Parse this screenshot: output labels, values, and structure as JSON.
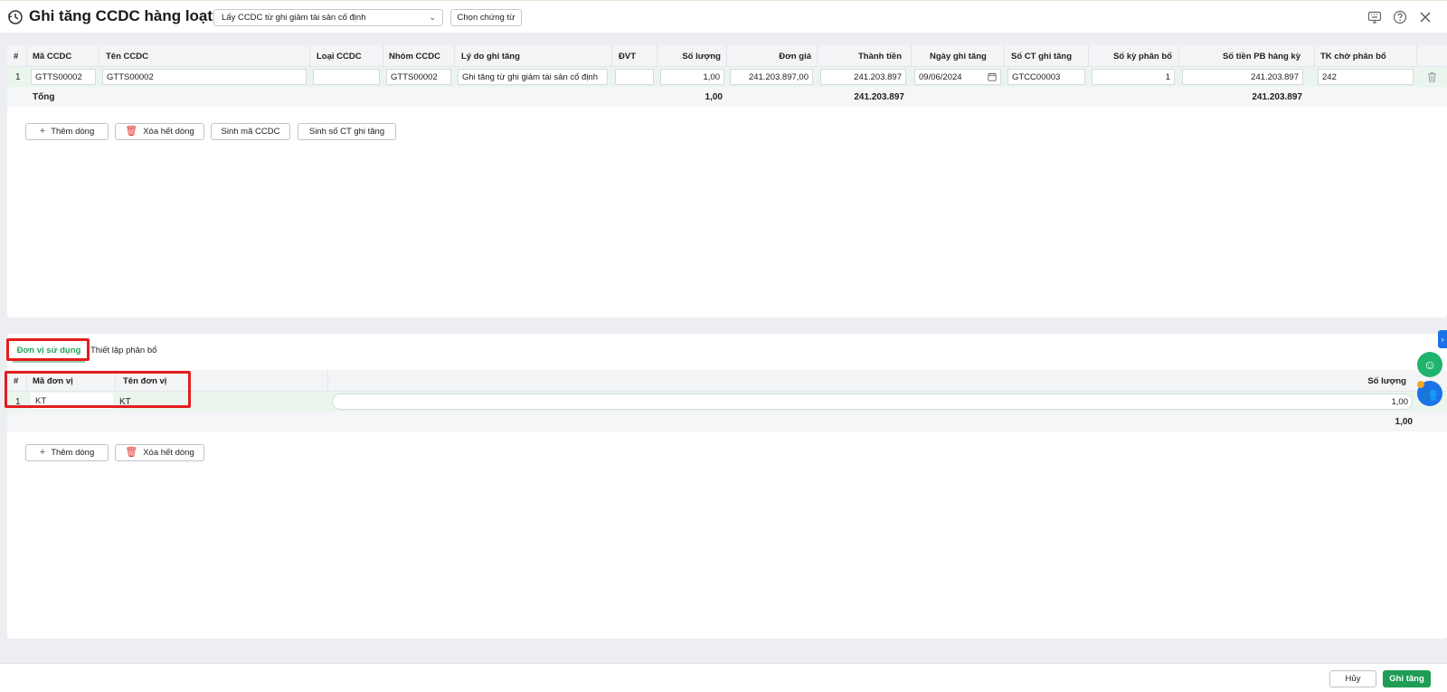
{
  "header": {
    "title": "Ghi tăng CCDC hàng loạt",
    "source_select": "Lấy CCDC từ ghi giảm tài sản cố định",
    "choose_voucher_label": "Chọn chứng từ"
  },
  "main_grid": {
    "columns": [
      "#",
      "Mã CCDC",
      "Tên CCDC",
      "Loại CCDC",
      "Nhóm CCDC",
      "Lý do ghi tăng",
      "ĐVT",
      "Số lượng",
      "Đơn giá",
      "Thành tiền",
      "Ngày ghi tăng",
      "Số CT ghi tăng",
      "Số kỳ phân bổ",
      "Số tiền PB hàng kỳ",
      "TK chờ phân bổ"
    ],
    "rows": [
      {
        "index": "1",
        "ma_ccdc": "GTTS00002",
        "ten_ccdc": "GTTS00002",
        "loai_ccdc": "",
        "nhom_ccdc": "GTTS00002",
        "ly_do": "Ghi tăng từ ghi giảm tài sản cố định",
        "dvt": "",
        "so_luong": "1,00",
        "don_gia": "241.203.897,00",
        "thanh_tien": "241.203.897",
        "ngay_ghi_tang": "09/06/2024",
        "so_ct": "GTCC00003",
        "so_ky": "1",
        "so_tien_pb": "241.203.897",
        "tk_cho_pb": "242"
      }
    ],
    "total": {
      "label": "Tổng",
      "so_luong": "1,00",
      "thanh_tien": "241.203.897",
      "so_tien_pb": "241.203.897"
    }
  },
  "main_actions": {
    "add_row": "Thêm dòng",
    "delete_all": "Xóa hết dòng",
    "gen_code": "Sinh mã CCDC",
    "gen_voucher": "Sinh số CT ghi tăng"
  },
  "tabs": {
    "unit": "Đơn vị sử dụng",
    "allocation": "Thiết lập phân bổ"
  },
  "unit_grid": {
    "columns": [
      "#",
      "Mã đơn vị",
      "Tên đơn vị",
      "Số lượng"
    ],
    "rows": [
      {
        "index": "1",
        "ma_don_vi": "KT",
        "ten_don_vi": "KT",
        "so_luong": "1,00"
      }
    ],
    "total": "1,00"
  },
  "unit_actions": {
    "add_row": "Thêm dòng",
    "delete_all": "Xóa hết dòng"
  },
  "footer": {
    "cancel": "Hủy",
    "save": "Ghi tăng"
  },
  "colors": {
    "primary_green": "#1f9d55",
    "highlight_red": "#e31d1d",
    "row_green": "#eaf5ee",
    "side_blue": "#1a73e8"
  }
}
